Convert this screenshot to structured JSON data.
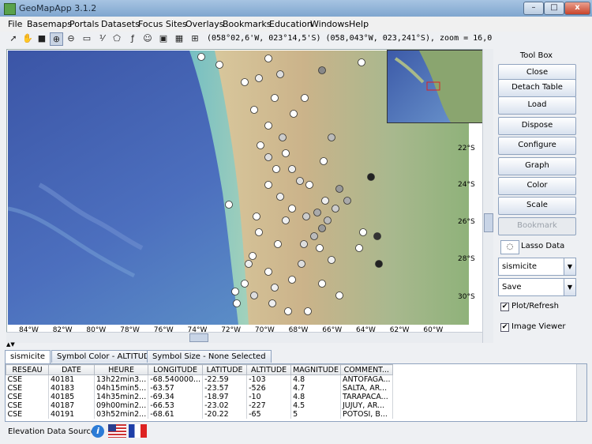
{
  "window": {
    "title": "GeoMapApp 3.1.2",
    "minimize": "–",
    "maximize": "□",
    "close": "x"
  },
  "menu": [
    "File",
    "Basemaps",
    "Portals",
    "Datasets",
    "Focus Sites",
    "Overlays",
    "Bookmarks",
    "Education",
    "Windows",
    "Help"
  ],
  "toolbar": {
    "coordinates": "(058°02,6'W, 023°14,5'S) (058,043°W, 023,241°S), zoom = 16,0"
  },
  "map": {
    "lat_labels": [
      "22°S",
      "24°S",
      "26°S",
      "28°S",
      "30°S"
    ],
    "lon_labels": [
      "84°W",
      "82°W",
      "80°W",
      "78°W",
      "76°W",
      "74°W",
      "72°W",
      "70°W",
      "68°W",
      "66°W",
      "64°W",
      "62°W",
      "60°W"
    ]
  },
  "toolbox": {
    "title": "Tool Box",
    "close": "Close",
    "detach": "Detach Table",
    "load": "Load",
    "dispose": "Dispose",
    "configure": "Configure",
    "graph": "Graph",
    "color": "Color",
    "scale": "Scale",
    "bookmark": "Bookmark",
    "lasso": "Lasso Data",
    "dataset_select": "sismicite",
    "save_select": "Save",
    "plot_refresh": "Plot/Refresh",
    "image_viewer": "Image Viewer"
  },
  "tabs": [
    "sismicite",
    "Symbol Color - ALTITUDE",
    "Symbol Size - None Selected"
  ],
  "table": {
    "columns": [
      "RESEAU",
      "DATE",
      "HEURE",
      "LONGITUDE",
      "LATITUDE",
      "ALTITUDE",
      "MAGNITUDE",
      "COMMENT..."
    ],
    "rows": [
      [
        "CSE",
        "40181",
        "13h22min3...",
        "-68.540000...",
        "-22.59",
        "-103",
        "4.8",
        "ANTOFAGA..."
      ],
      [
        "CSE",
        "40183",
        "04h15min5...",
        "-63.57",
        "-23.57",
        "-526",
        "4.7",
        "SALTA, AR..."
      ],
      [
        "CSE",
        "40185",
        "14h35min2...",
        "-69.34",
        "-18.97",
        "-10",
        "4.8",
        "TARAPACA..."
      ],
      [
        "CSE",
        "40187",
        "09h00min2...",
        "-66.53",
        "-23.02",
        "-227",
        "4.5",
        "JUJUY, AR..."
      ],
      [
        "CSE",
        "40191",
        "03h52min2...",
        "-68.61",
        "-20.22",
        "-65",
        "5",
        "POTOSI, B..."
      ]
    ]
  },
  "status": {
    "label": "Elevation Data Sources"
  }
}
